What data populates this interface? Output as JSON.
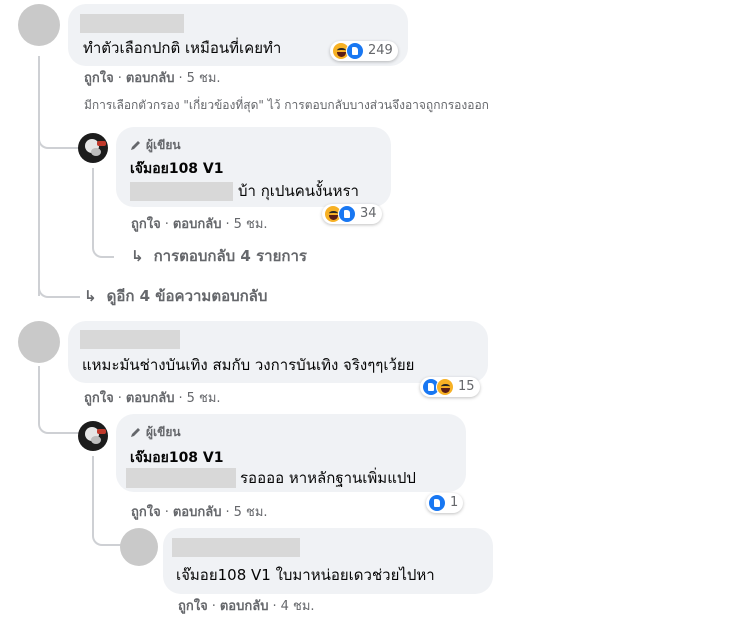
{
  "actions": {
    "like": "ถูกใจ",
    "reply": "ตอบกลับ",
    "sep": "·"
  },
  "author_badge": "ผู้เขียน",
  "reply_arrow": "↳",
  "thread1": {
    "comment": {
      "text": "ทำตัวเลือกปกติ เหมือนที่เคยทำ",
      "reaction_count": "249",
      "reactions": [
        "haha-icon",
        "like-icon"
      ],
      "time": "5 ชม."
    },
    "filter_notice": "มีการเลือกตัวกรอง \"เกี่ยวข้องที่สุด\" ไว้ การตอบกลับบางส่วนจึงอาจถูกกรองออก",
    "reply": {
      "name": "เจ๊มอย108 V1",
      "text": "บ้า กุเปนคนงั้นหรา",
      "reaction_count": "34",
      "reactions": [
        "haha-icon",
        "like-icon"
      ],
      "time": "5 ชม."
    },
    "nested_more": "การตอบกลับ 4 รายการ",
    "view_more": "ดูอีก 4 ข้อความตอบกลับ"
  },
  "thread2": {
    "comment": {
      "text": "แหมะมันช่างบันเทิง สมกับ วงการบันเทิง จริงๆๆเว้ยย",
      "reaction_count": "15",
      "reactions": [
        "like-icon",
        "haha-icon"
      ],
      "time": "5 ชม."
    },
    "reply": {
      "name": "เจ๊มอย108 V1",
      "text": "รออออ หาหลักฐานเพิ่มแปป",
      "reaction_count": "1",
      "reactions": [
        "like-icon"
      ],
      "time": "5 ชม."
    },
    "subreply": {
      "text": "เจ๊มอย108 V1 ใบมาหน่อยเดวช่วยไปหา",
      "time": "4 ชม."
    }
  },
  "colors": {
    "bubble": "#f0f2f5",
    "meta": "#65676b",
    "like": "#1877f2",
    "haha": "#f7b125",
    "thread_line": "#ced0d4"
  }
}
